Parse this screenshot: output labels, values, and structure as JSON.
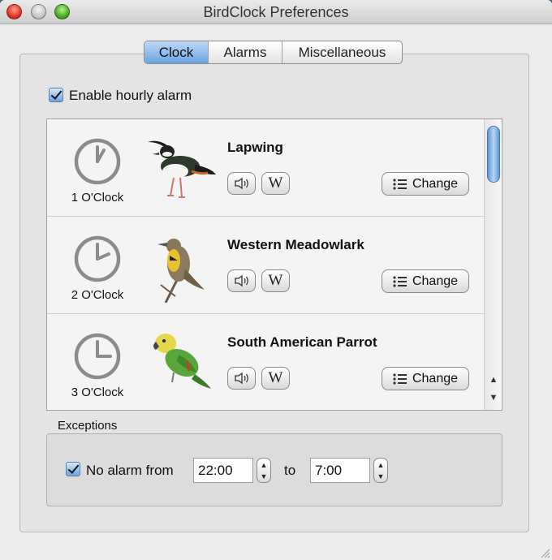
{
  "window": {
    "title": "BirdClock Preferences"
  },
  "tabs": [
    {
      "label": "Clock",
      "active": true
    },
    {
      "label": "Alarms",
      "active": false
    },
    {
      "label": "Miscellaneous",
      "active": false
    }
  ],
  "hourly": {
    "label": "Enable hourly alarm",
    "checked": true
  },
  "alarms": [
    {
      "hour_label": "1 O'Clock",
      "hour": 1,
      "bird": "Lapwing",
      "change_label": "Change",
      "wiki_label": "W",
      "bird_icon": "lapwing-bird-icon"
    },
    {
      "hour_label": "2 O'Clock",
      "hour": 2,
      "bird": "Western Meadowlark",
      "change_label": "Change",
      "wiki_label": "W",
      "bird_icon": "meadowlark-bird-icon"
    },
    {
      "hour_label": "3 O'Clock",
      "hour": 3,
      "bird": "South American Parrot",
      "change_label": "Change",
      "wiki_label": "W",
      "bird_icon": "parrot-bird-icon"
    }
  ],
  "exceptions": {
    "title": "Exceptions",
    "no_alarm_label": "No alarm from",
    "checked": true,
    "from": "22:00",
    "to_label": "to",
    "to": "7:00"
  },
  "colors": {
    "accent": "#6ba3e2",
    "clock_gray": "#8c8c8c"
  }
}
